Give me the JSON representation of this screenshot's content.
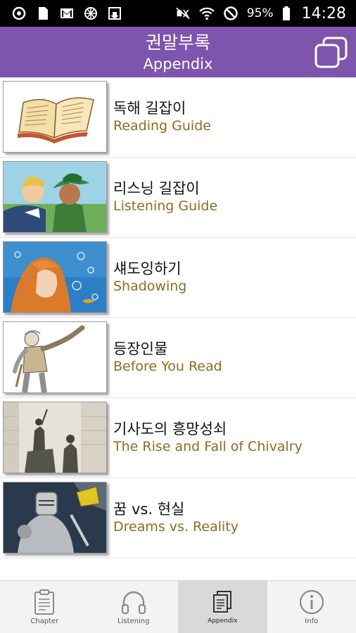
{
  "status": {
    "battery": "95%",
    "time": "14:28",
    "icons": [
      "sync-icon",
      "sim-icon",
      "gmail-icon",
      "network-icon",
      "download-icon",
      "mute-icon",
      "wifi-icon",
      "dnd-icon",
      "battery-icon"
    ]
  },
  "header": {
    "title": "권말부록",
    "subtitle": "Appendix",
    "action_icon": "copy-icon",
    "color": "#7d55ad"
  },
  "items": [
    {
      "kr": "독해 길잡이",
      "en": "Reading Guide",
      "thumb": "open-book"
    },
    {
      "kr": "리스닝 길잡이",
      "en": "Listening Guide",
      "thumb": "two-boys"
    },
    {
      "kr": "섀도잉하기",
      "en": "Shadowing",
      "thumb": "girl-underwater"
    },
    {
      "kr": "등장인물",
      "en": "Before You Read",
      "thumb": "knight-sketch"
    },
    {
      "kr": "기사도의 흥망성쇠",
      "en": "The Rise and Fall of Chivalry",
      "thumb": "statue-photo"
    },
    {
      "kr": "꿈 vs. 현실",
      "en": "Dreams vs. Reality",
      "thumb": "armored-knight"
    }
  ],
  "nav": [
    {
      "label": "Chapter",
      "icon": "clipboard-icon"
    },
    {
      "label": "Listening",
      "icon": "headphones-icon"
    },
    {
      "label": "Appendix",
      "icon": "pages-icon",
      "active": true
    },
    {
      "label": "Info",
      "icon": "info-icon"
    }
  ],
  "colors": {
    "accent": "#7d55ad",
    "subtitle_text": "#8a6e1f"
  }
}
